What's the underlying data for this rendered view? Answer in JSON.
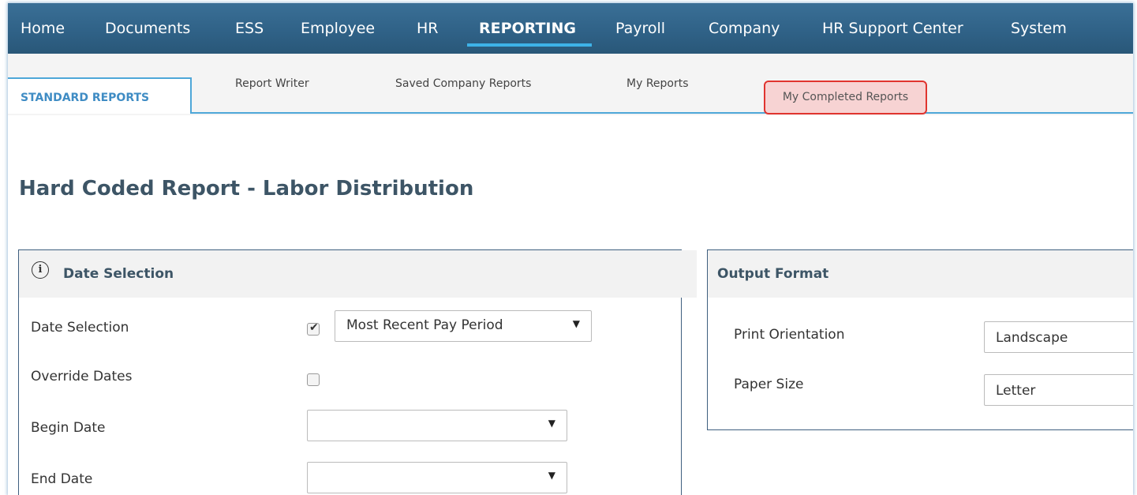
{
  "topnav": {
    "items": [
      "Home",
      "Documents",
      "ESS",
      "Employee",
      "HR",
      "REPORTING",
      "Payroll",
      "Company",
      "HR Support Center",
      "System"
    ]
  },
  "subtabs": {
    "items": [
      "STANDARD REPORTS",
      "Report Writer",
      "Saved Company Reports",
      "My Reports",
      "My Completed Reports"
    ]
  },
  "page": {
    "title": "Hard Coded Report - Labor Distribution"
  },
  "date_panel": {
    "heading": "Date Selection",
    "fields": {
      "date_selection": {
        "label": "Date Selection",
        "checked": true,
        "value": "Most Recent Pay Period"
      },
      "override_dates": {
        "label": "Override Dates",
        "checked": false
      },
      "begin_date": {
        "label": "Begin Date",
        "value": ""
      },
      "end_date": {
        "label": "End Date",
        "value": ""
      }
    }
  },
  "output_panel": {
    "heading": "Output Format",
    "print_orientation": {
      "label": "Print Orientation",
      "value": "Landscape"
    },
    "paper_size": {
      "label": "Paper Size",
      "value": "Letter"
    }
  },
  "colors": {
    "nav_bg": "#2f6186",
    "accent": "#3db2e8",
    "highlight_border": "#e0342f"
  }
}
